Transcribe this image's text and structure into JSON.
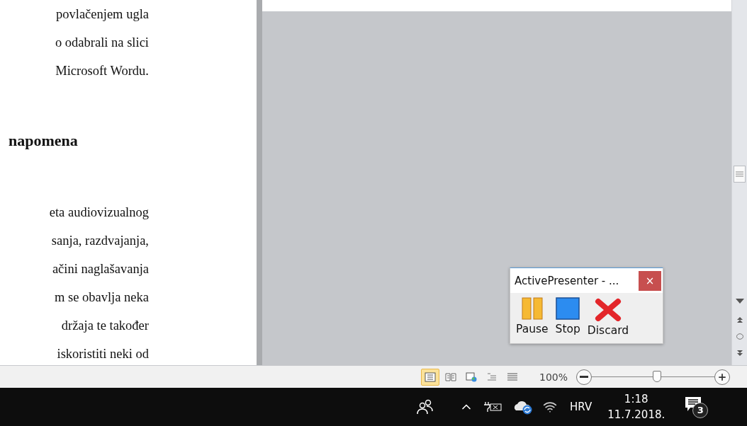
{
  "document": {
    "lines_top": [
      "povlačenjem ugla",
      "o odabrali na slici",
      "Microsoft Wordu."
    ],
    "heading": "napomena",
    "lines_bottom": [
      "eta audiovizualnog",
      "sanja, razdvajanja,",
      "ačini naglašavanja",
      "m se obavlja neka",
      "držaja te također",
      "iskoristiti neki od"
    ]
  },
  "recorder": {
    "title": "ActivePresenter - ...",
    "close": "×",
    "buttons": [
      {
        "kind": "pause",
        "label": "Pause"
      },
      {
        "kind": "stop",
        "label": "Stop"
      },
      {
        "kind": "discard",
        "label": "Discard"
      }
    ]
  },
  "status_bar": {
    "views": [
      {
        "kind": "print",
        "selected": true
      },
      {
        "kind": "reading",
        "selected": false
      },
      {
        "kind": "web",
        "selected": false
      },
      {
        "kind": "outline",
        "selected": false
      },
      {
        "kind": "draft",
        "selected": false
      }
    ],
    "zoom": "100%",
    "zoom_slider": {
      "level": 0.53
    }
  },
  "taskbar": {
    "language": "HRV",
    "time": "1:18",
    "date": "11.7.2018.",
    "notifications": "3"
  }
}
